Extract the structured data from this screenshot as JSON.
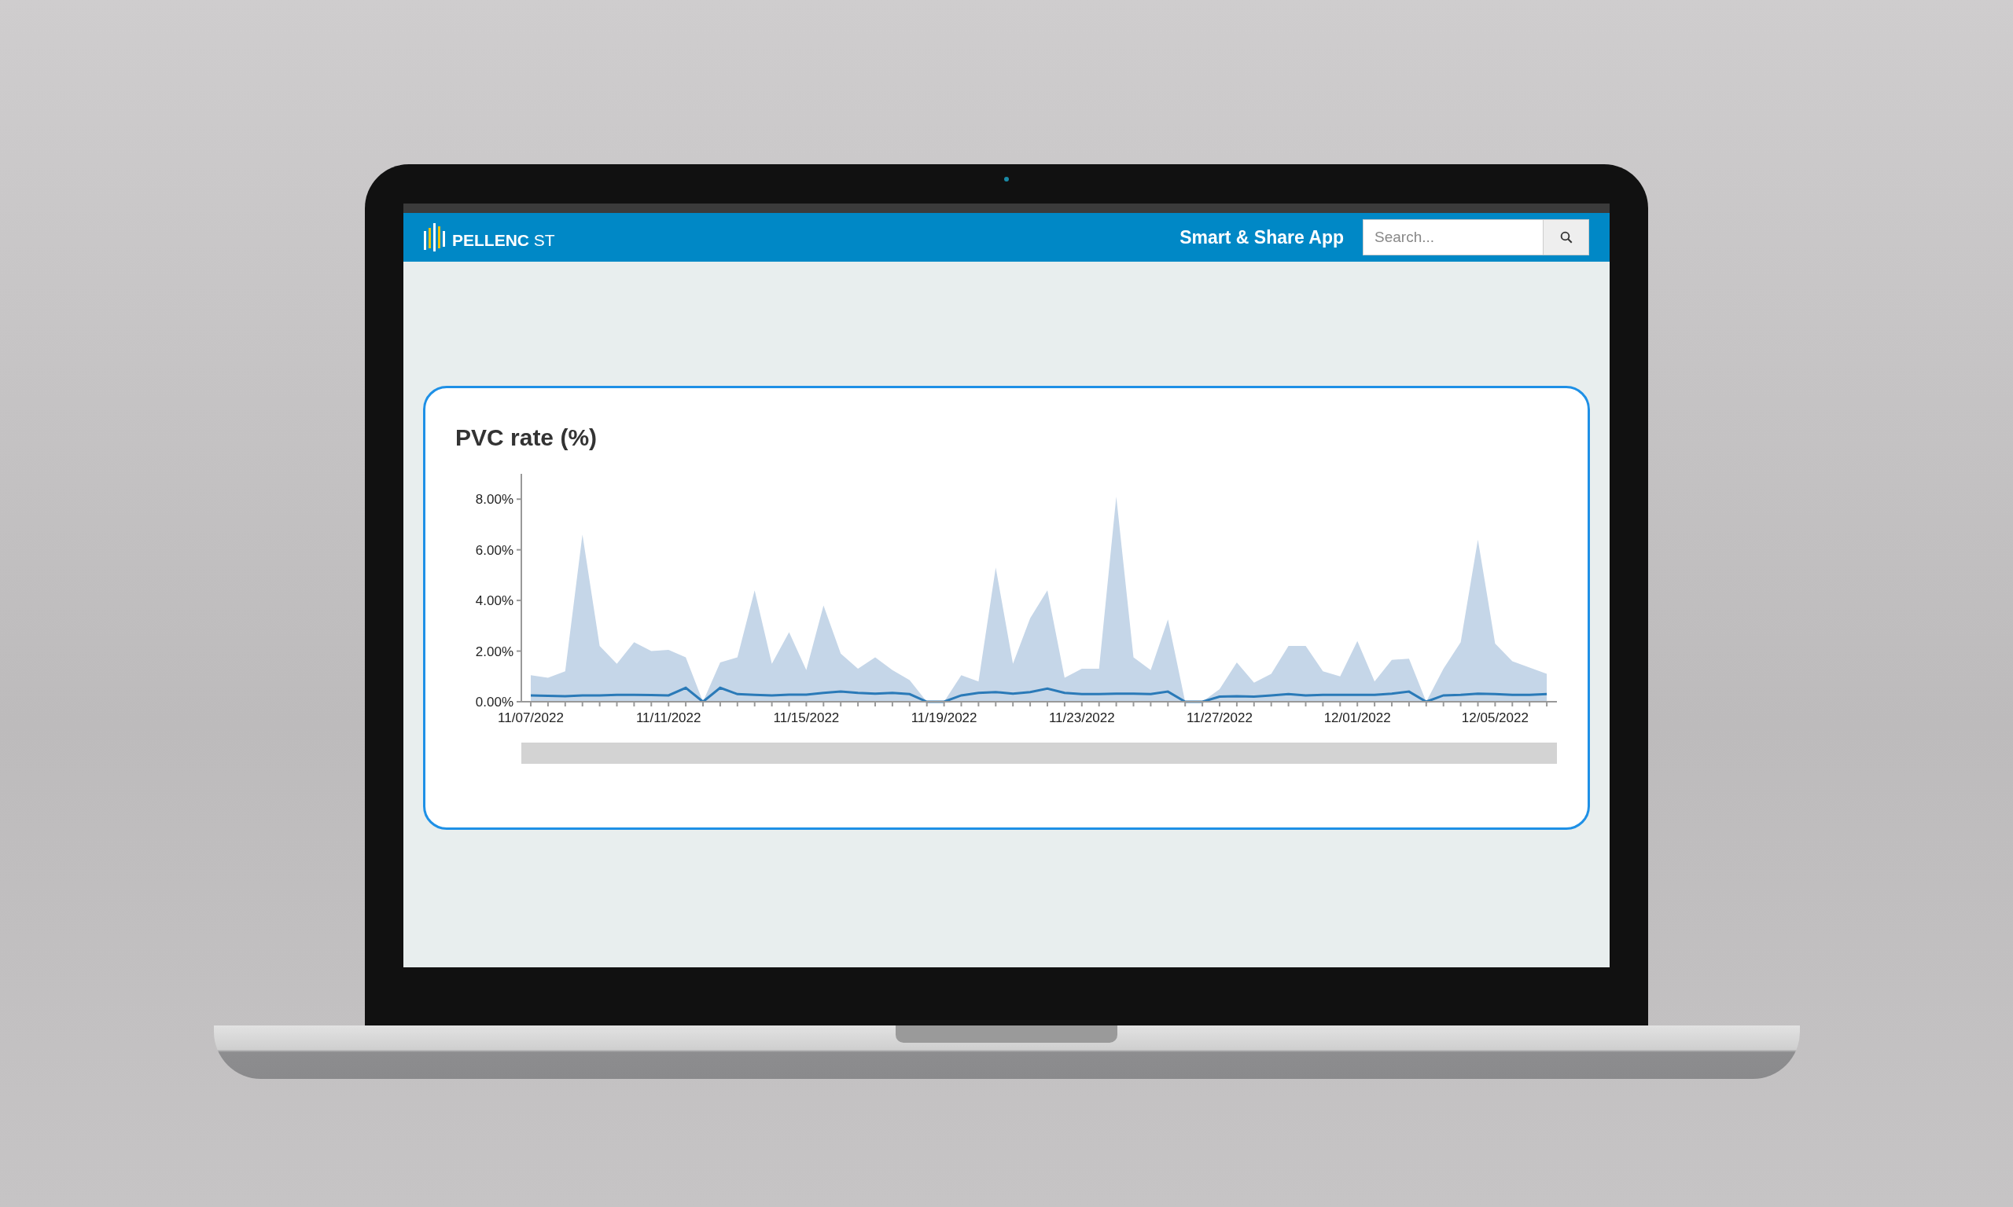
{
  "header": {
    "logo": {
      "name": "PELLENC",
      "suffix": "ST"
    },
    "app_title": "Smart & Share App",
    "search": {
      "placeholder": "Search..."
    }
  },
  "card": {
    "title": "PVC rate (%)",
    "chart_data": {
      "type": "area",
      "categories": [
        "11/07/2022",
        null,
        null,
        null,
        null,
        null,
        null,
        null,
        "11/11/2022",
        null,
        null,
        null,
        null,
        null,
        null,
        null,
        "11/15/2022",
        null,
        null,
        null,
        null,
        null,
        null,
        null,
        "11/19/2022",
        null,
        null,
        null,
        null,
        null,
        null,
        null,
        "11/23/2022",
        null,
        null,
        null,
        null,
        null,
        null,
        null,
        "11/27/2022",
        null,
        null,
        null,
        null,
        null,
        null,
        null,
        "12/01/2022",
        null,
        null,
        null,
        null,
        null,
        null,
        null,
        "12/05/2022",
        null,
        null,
        null
      ],
      "series": [
        {
          "type": "area",
          "color": "#c5d6e8",
          "values": [
            1.05,
            0.95,
            1.2,
            6.6,
            2.2,
            1.5,
            2.35,
            2.0,
            2.05,
            1.75,
            0,
            1.55,
            1.75,
            4.4,
            1.5,
            2.75,
            1.25,
            3.8,
            1.9,
            1.3,
            1.75,
            1.25,
            0.85,
            0,
            0,
            1.05,
            0.8,
            5.3,
            1.5,
            3.3,
            4.4,
            0.95,
            1.3,
            1.3,
            8.1,
            1.75,
            1.25,
            3.25,
            0,
            0,
            0.5,
            1.55,
            0.75,
            1.1,
            2.2,
            2.2,
            1.2,
            1.0,
            2.4,
            0.8,
            1.65,
            1.7,
            0,
            1.3,
            2.35,
            6.4,
            2.3,
            1.6,
            1.35,
            1.1
          ]
        },
        {
          "type": "line",
          "color": "#2a7ab8",
          "values": [
            0.25,
            0.23,
            0.22,
            0.25,
            0.25,
            0.27,
            0.27,
            0.26,
            0.25,
            0.55,
            0,
            0.55,
            0.3,
            0.27,
            0.25,
            0.28,
            0.28,
            0.35,
            0.4,
            0.35,
            0.32,
            0.35,
            0.3,
            0,
            0,
            0.25,
            0.35,
            0.38,
            0.32,
            0.38,
            0.52,
            0.35,
            0.3,
            0.3,
            0.32,
            0.32,
            0.3,
            0.4,
            0,
            0,
            0.2,
            0.22,
            0.2,
            0.25,
            0.3,
            0.25,
            0.27,
            0.27,
            0.27,
            0.27,
            0.32,
            0.4,
            0,
            0.25,
            0.27,
            0.32,
            0.3,
            0.27,
            0.27,
            0.3
          ]
        }
      ],
      "ylim": [
        0,
        9
      ],
      "yticks": [
        {
          "value": 0,
          "label": "0.00%"
        },
        {
          "value": 2,
          "label": "2.00%"
        },
        {
          "value": 4,
          "label": "4.00%"
        },
        {
          "value": 6,
          "label": "6.00%"
        },
        {
          "value": 8,
          "label": "8.00%"
        }
      ]
    }
  }
}
